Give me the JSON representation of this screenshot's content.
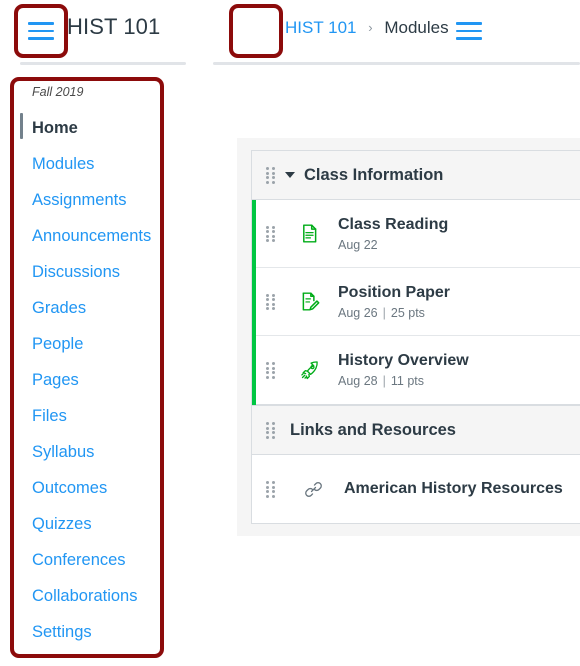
{
  "left_panel": {
    "menu_button_icon": "hamburger-menu-icon",
    "course_title": "HIST 101",
    "term_label": "Fall 2019",
    "nav_items": [
      {
        "label": "Home",
        "active": true
      },
      {
        "label": "Modules",
        "active": false
      },
      {
        "label": "Assignments",
        "active": false
      },
      {
        "label": "Announcements",
        "active": false
      },
      {
        "label": "Discussions",
        "active": false
      },
      {
        "label": "Grades",
        "active": false
      },
      {
        "label": "People",
        "active": false
      },
      {
        "label": "Pages",
        "active": false
      },
      {
        "label": "Files",
        "active": false
      },
      {
        "label": "Syllabus",
        "active": false
      },
      {
        "label": "Outcomes",
        "active": false
      },
      {
        "label": "Quizzes",
        "active": false
      },
      {
        "label": "Conferences",
        "active": false
      },
      {
        "label": "Collaborations",
        "active": false
      },
      {
        "label": "Settings",
        "active": false
      }
    ]
  },
  "right_panel": {
    "menu_button_icon": "hamburger-menu-icon",
    "breadcrumb": {
      "course": "HIST 101",
      "separator": "›",
      "current": "Modules"
    }
  },
  "modules": [
    {
      "name": "Class Information",
      "collapse_icon": "chevron-down-icon",
      "drag_icon": "drag-handle-icon",
      "items": [
        {
          "title": "Class Reading",
          "due": "Aug 22",
          "points": "",
          "icon": "document-page-icon",
          "icon_color": "#00AC18",
          "published": true
        },
        {
          "title": "Position Paper",
          "due": "Aug 26",
          "points": "25 pts",
          "icon": "assignment-edit-icon",
          "icon_color": "#00AC18",
          "published": true
        },
        {
          "title": "History Overview",
          "due": "Aug 28",
          "points": "11 pts",
          "icon": "quiz-rocket-icon",
          "icon_color": "#00AC18",
          "published": true
        }
      ]
    },
    {
      "name": "Links and Resources",
      "collapse_icon": "",
      "drag_icon": "drag-handle-icon",
      "items": [
        {
          "title": "American History Resources",
          "due": "",
          "points": "",
          "icon": "external-link-chain-icon",
          "icon_color": "#6B7780",
          "published": false
        }
      ]
    }
  ],
  "annotations": {
    "color": "#8C0B0B",
    "boxes": [
      "left-global-nav-menu-button",
      "right-global-nav-menu-button",
      "course-navigation-menu"
    ]
  },
  "theme": {
    "link_blue": "#2196F3",
    "text_dark": "#2D3B45",
    "published_green": "#00C642",
    "panel_gray": "#F5F5F5"
  }
}
